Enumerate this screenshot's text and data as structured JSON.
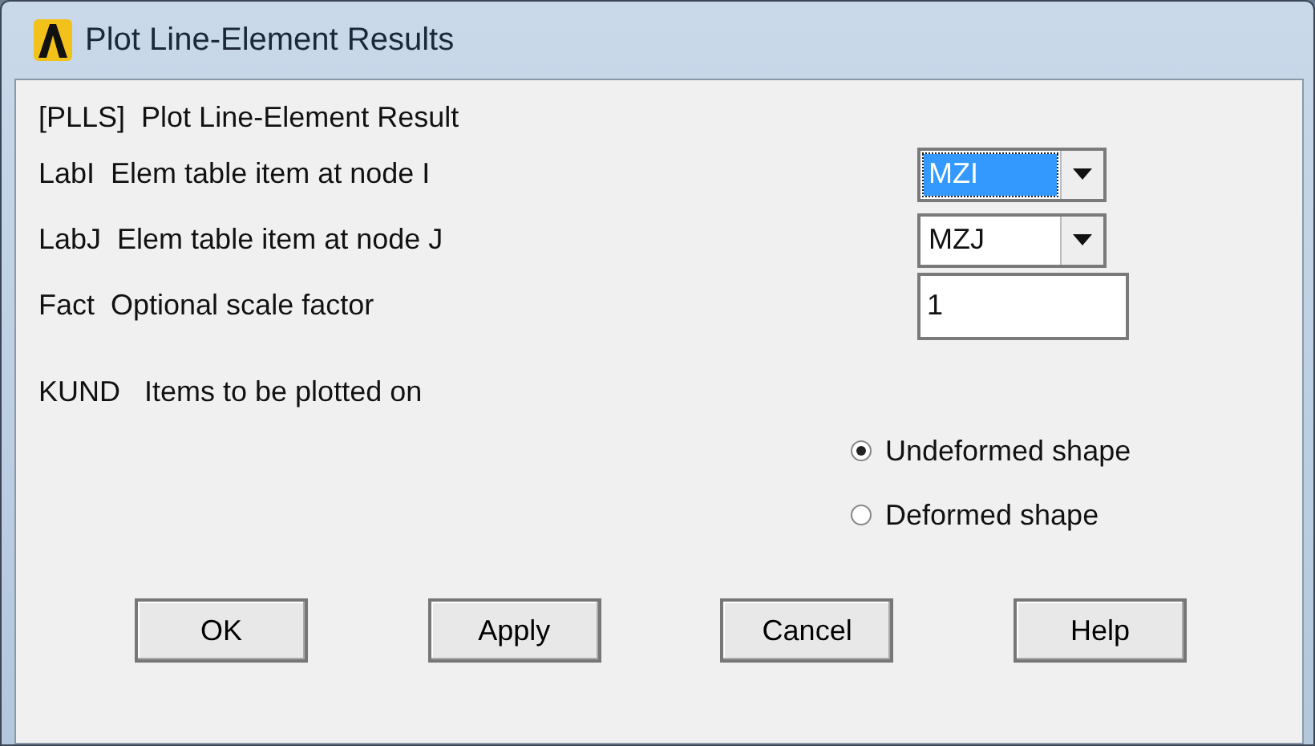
{
  "window": {
    "title": "Plot Line-Element Results"
  },
  "header": "[PLLS]  Plot Line-Element Result",
  "fields": [
    {
      "kind": "dropdown",
      "label": "LabI  Elem table item at node I",
      "value": "MZI",
      "focused": true
    },
    {
      "kind": "dropdown",
      "label": "LabJ  Elem table item at node J",
      "value": "MZJ",
      "focused": false
    },
    {
      "kind": "text",
      "label": "Fact  Optional scale factor",
      "value": "1"
    }
  ],
  "kund": {
    "label": "KUND   Items to be plotted on",
    "options": [
      {
        "label": "Undeformed shape",
        "selected": true
      },
      {
        "label": "Deformed shape",
        "selected": false
      }
    ]
  },
  "buttons": [
    "OK",
    "Apply",
    "Cancel",
    "Help"
  ]
}
